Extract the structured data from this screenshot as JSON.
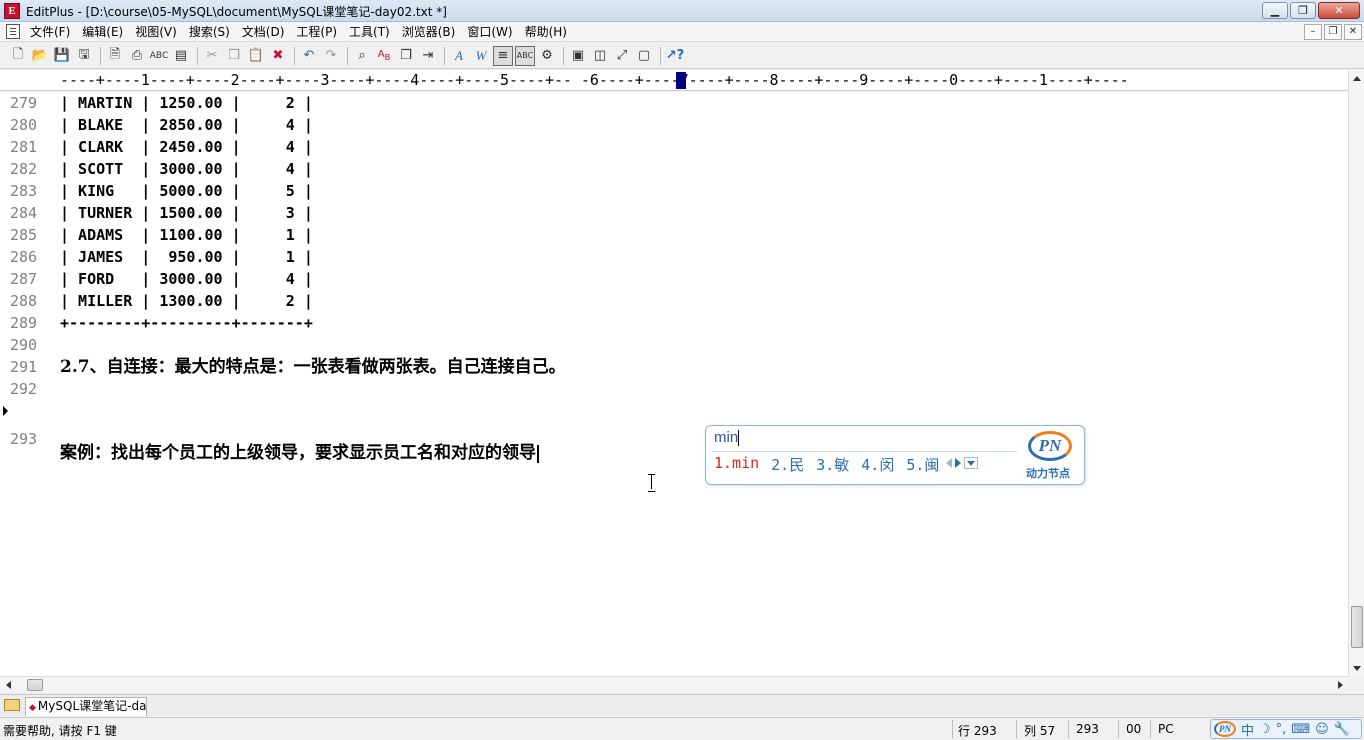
{
  "window": {
    "title": "EditPlus - [D:\\course\\05-MySQL\\document\\MySQL课堂笔记-day02.txt *]",
    "app_icon_letter": "E",
    "minimize_icon": "minimize-icon",
    "maximize_icon": "restore-icon",
    "close_icon": "close-icon"
  },
  "menu": {
    "items": [
      "文件(F)",
      "编辑(E)",
      "视图(V)",
      "搜索(S)",
      "文档(D)",
      "工程(P)",
      "工具(T)",
      "浏览器(B)",
      "窗口(W)",
      "帮助(H)"
    ]
  },
  "toolbar": {
    "buttons": [
      "new-icon",
      "open-icon",
      "save-icon",
      "save-all-icon",
      "print-preview-icon",
      "print-icon",
      "spellcheck-icon",
      "html-preview-icon",
      "cut-icon",
      "copy-icon",
      "paste-icon",
      "delete-icon",
      "undo-icon",
      "redo-icon",
      "find-icon",
      "replace-icon",
      "find-next-icon",
      "goto-icon",
      "font-icon",
      "word-wrap-icon",
      "line-number-icon",
      "column-select-icon",
      "settings-icon",
      "browser-icon",
      "split-icon",
      "fullscreen-icon",
      "cliptext-icon",
      "help-icon"
    ]
  },
  "ruler": {
    "text": "----+----1----+----2----+----3----+----4----+----5----+-- -6----+----7----+----8----+----9----+----0----+----1----+----"
  },
  "editor": {
    "current_line": "293",
    "lines": [
      {
        "num": "279",
        "text": "| MARTIN | 1250.00 |     2 |"
      },
      {
        "num": "280",
        "text": "| BLAKE  | 2850.00 |     4 |"
      },
      {
        "num": "281",
        "text": "| CLARK  | 2450.00 |     4 |"
      },
      {
        "num": "282",
        "text": "| SCOTT  | 3000.00 |     4 |"
      },
      {
        "num": "283",
        "text": "| KING   | 5000.00 |     5 |"
      },
      {
        "num": "284",
        "text": "| TURNER | 1500.00 |     3 |"
      },
      {
        "num": "285",
        "text": "| ADAMS  | 1100.00 |     1 |"
      },
      {
        "num": "286",
        "text": "| JAMES  |  950.00 |     1 |"
      },
      {
        "num": "287",
        "text": "| FORD   | 3000.00 |     4 |"
      },
      {
        "num": "288",
        "text": "| MILLER | 1300.00 |     2 |"
      },
      {
        "num": "289",
        "text": "+--------+---------+-------+"
      },
      {
        "num": "290",
        "text": ""
      },
      {
        "num": "291",
        "text": "2.7、自连接：最大的特点是：一张表看做两张表。自己连接自己。"
      },
      {
        "num": "292",
        "text": ""
      },
      {
        "num": "293",
        "text": "案例：找出每个员工的上级领导，要求显示员工名和对应的领导"
      }
    ]
  },
  "ime_popup": {
    "input": "min",
    "candidates": [
      "1.min",
      "2.民",
      "3.敏",
      "4.闵",
      "5.闽"
    ],
    "logo_mark": "PN",
    "logo_text": "动力节点"
  },
  "tabs": {
    "document_tab": "MySQL课堂笔记-da"
  },
  "status": {
    "help": "需要帮助, 请按 F1 键",
    "row": "行 293",
    "col": "列 57",
    "lines_total": "293",
    "code": "00",
    "format": "PC",
    "ime_mode": "中",
    "ime_mode_icon": "moon-icon"
  },
  "colors": {
    "line_number": "#808080",
    "ime_candidate": "#2a6fb0",
    "ime_active_candidate": "#e1251b",
    "ruler_cursor": "#000080"
  }
}
